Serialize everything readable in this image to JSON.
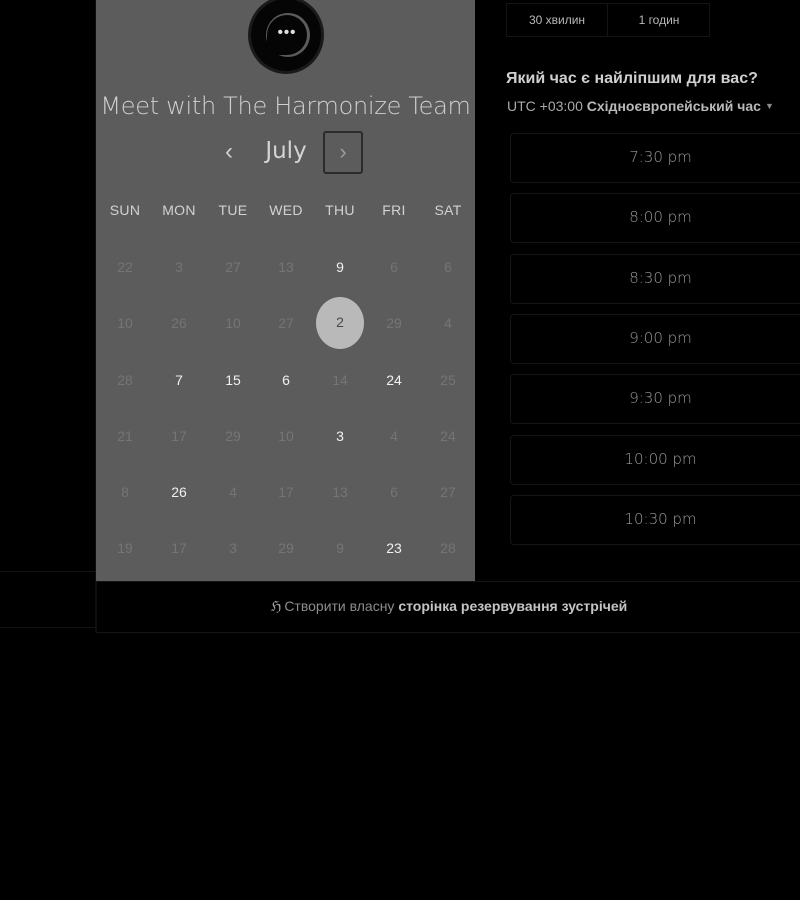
{
  "calendar": {
    "title": "Meet with The Harmonize Team",
    "logo_glyph": "•••",
    "month": "July",
    "prev_glyph": "‹",
    "next_glyph": "›",
    "weekdays": [
      "SUN",
      "MON",
      "TUE",
      "WED",
      "THU",
      "FRI",
      "SAT"
    ],
    "weeks": [
      [
        {
          "d": "22",
          "a": false
        },
        {
          "d": "3",
          "a": false
        },
        {
          "d": "27",
          "a": false
        },
        {
          "d": "13",
          "a": false
        },
        {
          "d": "9",
          "a": true
        },
        {
          "d": "6",
          "a": false
        },
        {
          "d": "6",
          "a": false
        }
      ],
      [
        {
          "d": "10",
          "a": false
        },
        {
          "d": "26",
          "a": false
        },
        {
          "d": "10",
          "a": false
        },
        {
          "d": "27",
          "a": false
        },
        {
          "d": "2",
          "a": true,
          "selected": true
        },
        {
          "d": "29",
          "a": false
        },
        {
          "d": "4",
          "a": false
        }
      ],
      [
        {
          "d": "28",
          "a": false
        },
        {
          "d": "7",
          "a": true
        },
        {
          "d": "15",
          "a": true
        },
        {
          "d": "6",
          "a": true
        },
        {
          "d": "14",
          "a": false
        },
        {
          "d": "24",
          "a": true
        },
        {
          "d": "25",
          "a": false
        }
      ],
      [
        {
          "d": "21",
          "a": false
        },
        {
          "d": "17",
          "a": false
        },
        {
          "d": "29",
          "a": false
        },
        {
          "d": "10",
          "a": false
        },
        {
          "d": "3",
          "a": true
        },
        {
          "d": "4",
          "a": false
        },
        {
          "d": "24",
          "a": false
        }
      ],
      [
        {
          "d": "8",
          "a": false
        },
        {
          "d": "26",
          "a": true
        },
        {
          "d": "4",
          "a": false
        },
        {
          "d": "17",
          "a": false
        },
        {
          "d": "13",
          "a": false
        },
        {
          "d": "6",
          "a": false
        },
        {
          "d": "27",
          "a": false
        }
      ],
      [
        {
          "d": "19",
          "a": false
        },
        {
          "d": "17",
          "a": false
        },
        {
          "d": "3",
          "a": false
        },
        {
          "d": "29",
          "a": false
        },
        {
          "d": "9",
          "a": false
        },
        {
          "d": "23",
          "a": true
        },
        {
          "d": "28",
          "a": false
        }
      ]
    ]
  },
  "durations": [
    "30 хвилин",
    "1 годин"
  ],
  "question": "Який час є найліпшим для вас?",
  "timezone": {
    "offset": "UTC +03:00",
    "name": "Східноєвропейський час",
    "caret": "▼"
  },
  "slots": [
    "7:30 pm",
    "8:00 pm",
    "8:30 pm",
    "9:00 pm",
    "9:30 pm",
    "10:00 pm",
    "10:30 pm"
  ],
  "footer": {
    "icon": "ℌ",
    "prefix": "Створити власну",
    "link": "сторінка резервування зустрічей"
  }
}
